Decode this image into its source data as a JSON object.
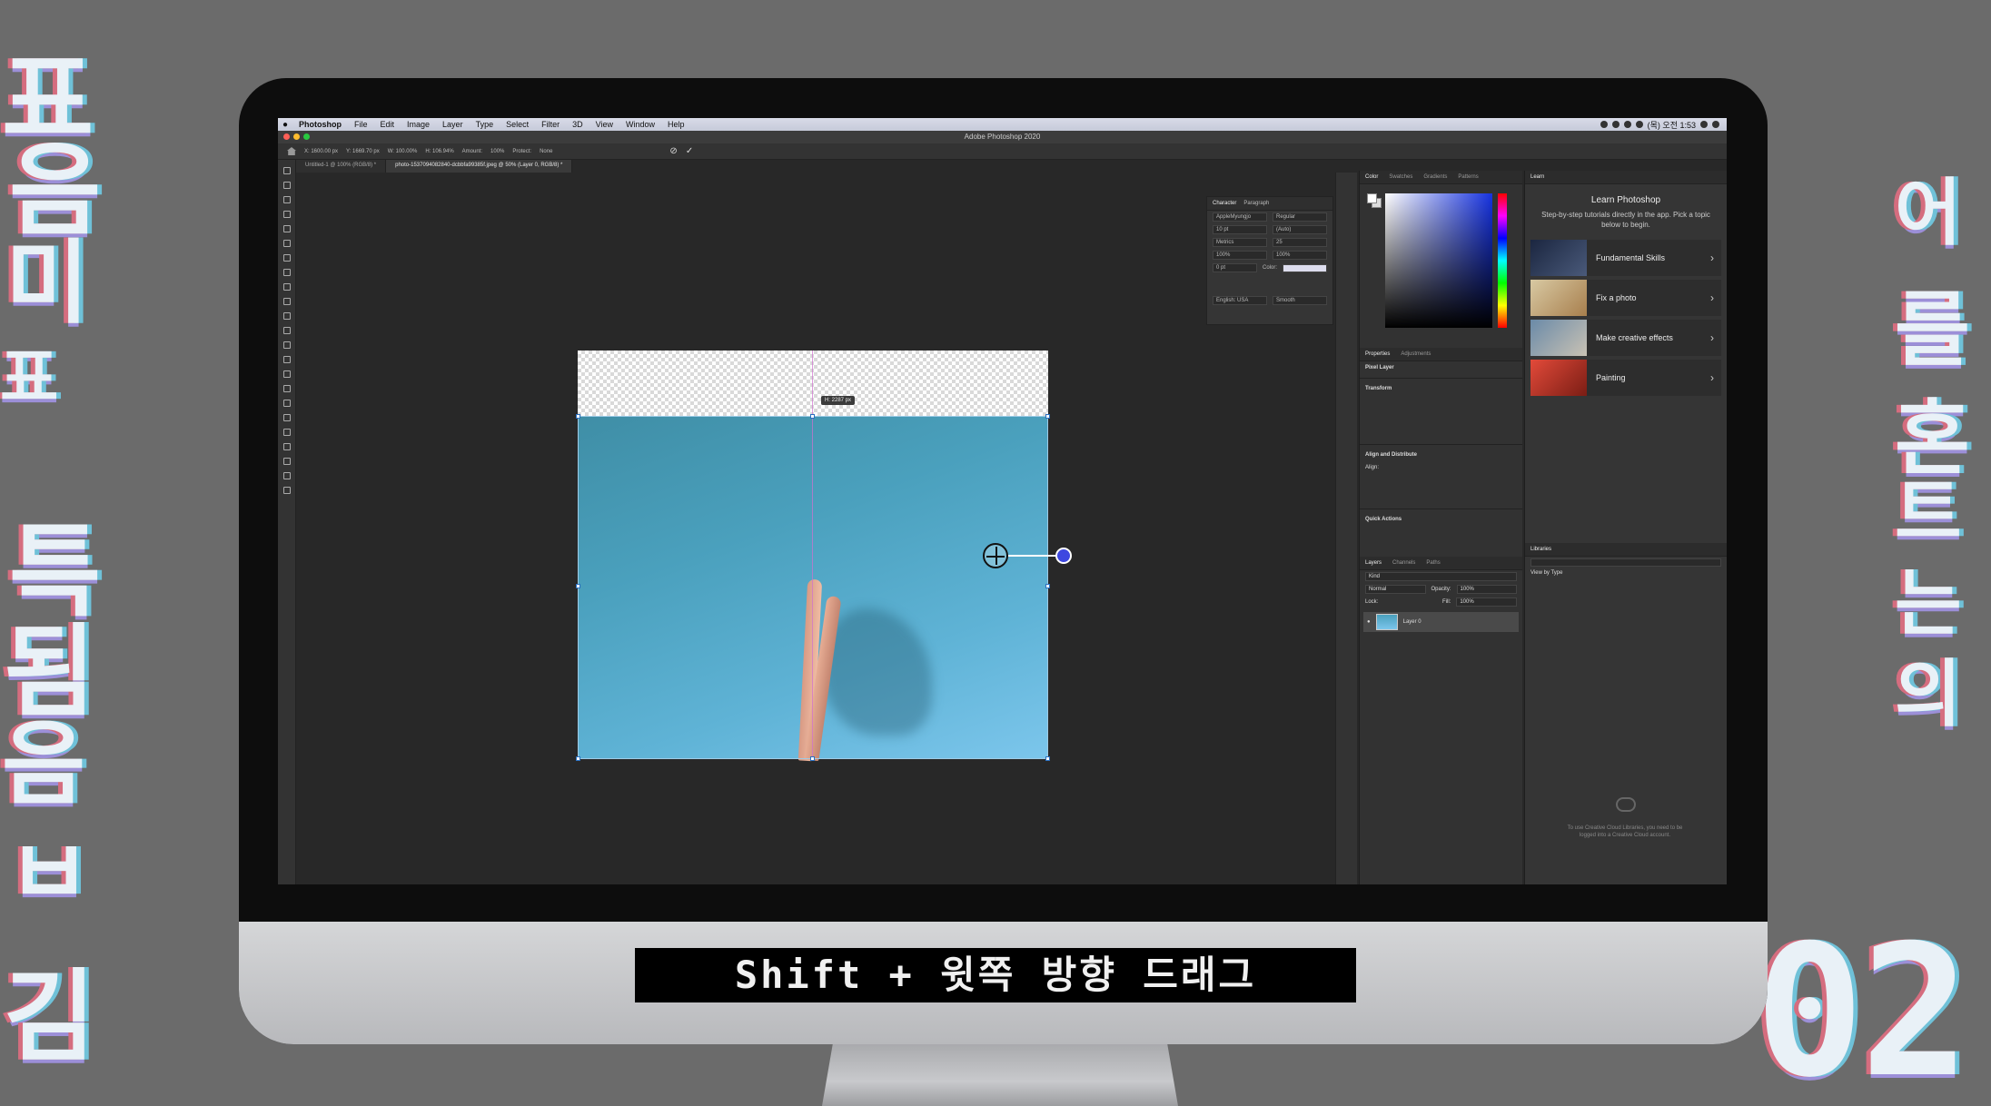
{
  "decorations": {
    "left_glyphs": [
      "표",
      "음",
      "미",
      "표",
      "특",
      "됨",
      "음",
      "ㅂ",
      "김"
    ],
    "right_glyphs": [
      "어",
      "를",
      "혼",
      "트",
      "는",
      "의"
    ],
    "bottom_right_text": "02"
  },
  "caption": "Shift + 윗쪽 방향 드래그",
  "menubar": {
    "apple": "",
    "app_name": "Photoshop",
    "items": [
      "File",
      "Edit",
      "Image",
      "Layer",
      "Type",
      "Select",
      "Filter",
      "3D",
      "View",
      "Window",
      "Help"
    ],
    "clock": "(목) 오전 1:53"
  },
  "window_title": "Adobe Photoshop 2020",
  "options_bar": {
    "x": "X: 1600.00 px",
    "y": "Y: 1669.70 px",
    "w": "W: 100.00%",
    "h": "H: 106.94%",
    "amount_label": "Amount:",
    "amount_value": "100%",
    "protect_label": "Protect:",
    "protect_value": "None",
    "cancel_icon": "⊘",
    "commit_icon": "✓"
  },
  "doc_tabs": [
    "Untitled-1 @ 100% (RGB/8) *",
    "photo-1537094082840-dcbbfa99385f.jpeg @ 50% (Layer 0, RGB/8) *"
  ],
  "canvas": {
    "hud_readout": "H: 2287 px"
  },
  "character_panel": {
    "tabs": [
      "Character",
      "Paragraph"
    ],
    "font_family": "AppleMyungjo",
    "font_style": "Regular",
    "size": "10 pt",
    "leading": "(Auto)",
    "kerning": "Metrics",
    "tracking": "25",
    "vscale": "100%",
    "hscale": "100%",
    "baseline": "0 pt",
    "color_label": "Color:",
    "language": "English: USA",
    "aa": "Smooth"
  },
  "color_panel": {
    "tabs": [
      "Color",
      "Swatches",
      "Gradients",
      "Patterns"
    ]
  },
  "properties_panel": {
    "tabs": [
      "Properties",
      "Adjustments"
    ],
    "layer_type": "Pixel Layer",
    "transform": "Transform",
    "align": "Align and Distribute",
    "align_label": "Align:",
    "quick": "Quick Actions"
  },
  "layers_panel": {
    "tabs": [
      "Layers",
      "Channels",
      "Paths"
    ],
    "kind": "Kind",
    "blend": "Normal",
    "opacity_label": "Opacity:",
    "opacity": "100%",
    "lock_label": "Lock:",
    "fill_label": "Fill:",
    "fill": "100%",
    "layer_name": "Layer 0"
  },
  "learn_panel": {
    "tab": "Learn",
    "title": "Learn Photoshop",
    "desc": "Step-by-step tutorials directly in the app. Pick a topic below to begin.",
    "items": [
      "Fundamental Skills",
      "Fix a photo",
      "Make creative effects",
      "Painting"
    ]
  },
  "libraries_panel": {
    "tab": "Libraries",
    "view_by": "View by Type",
    "note": "To use Creative Cloud Libraries, you need to be logged into a Creative Cloud account."
  },
  "colors": {
    "accent_drag": "#3d48e0",
    "photo_blue": "#5fb3d6"
  }
}
